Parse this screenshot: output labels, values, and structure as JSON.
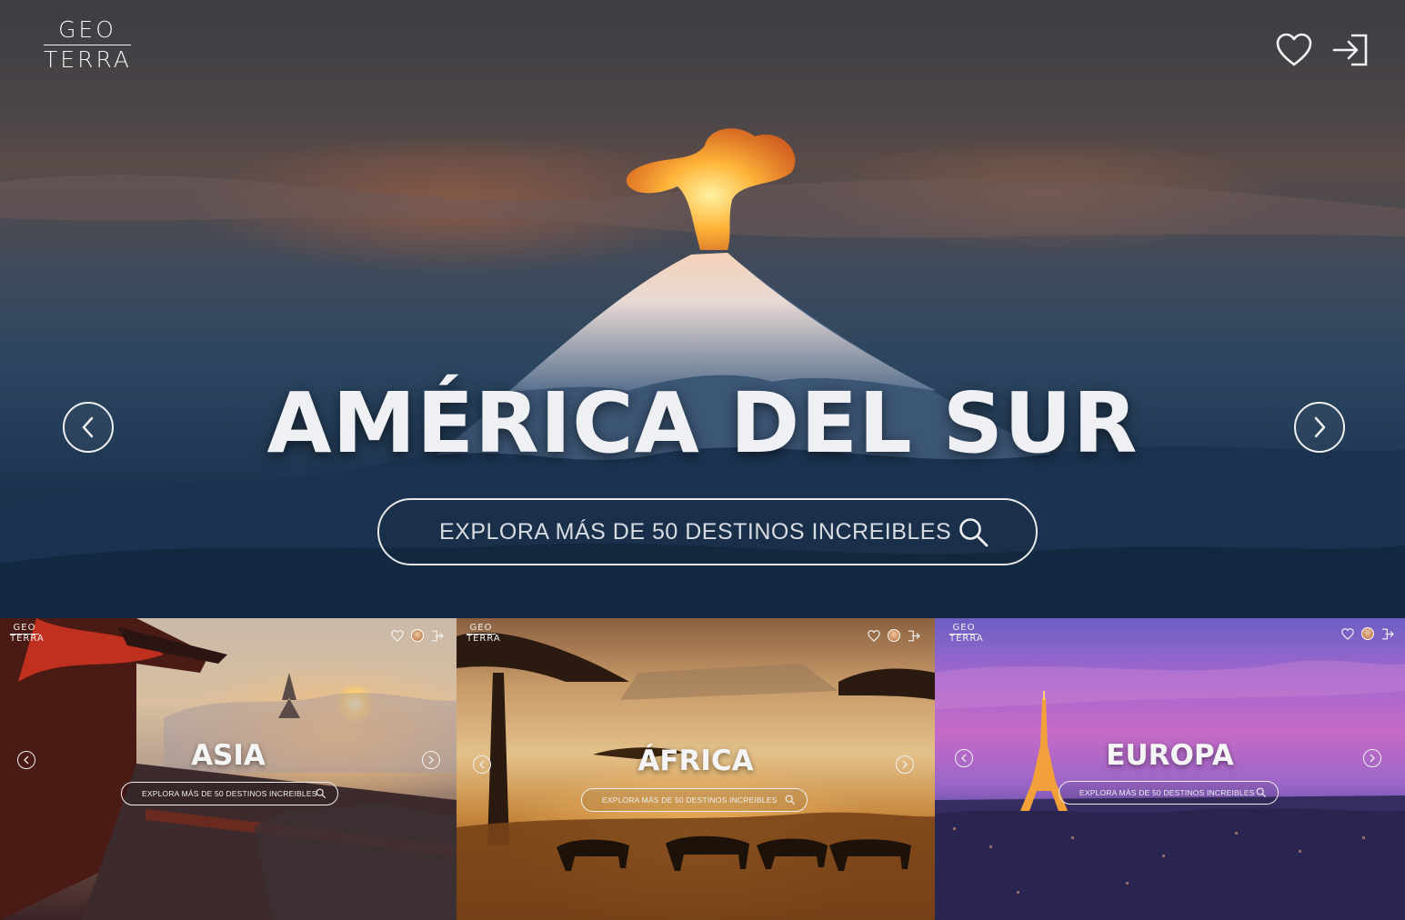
{
  "brand": {
    "line1": "GEO",
    "line2": "TERRA"
  },
  "header": {
    "favorites_icon": "heart-icon",
    "login_icon": "sign-in-icon"
  },
  "hero": {
    "title": "AMÉRICA DEL SUR",
    "search_placeholder": "EXPLORA MÁS DE 50 DESTINOS INCREIBLES",
    "prev_icon": "chevron-left-icon",
    "next_icon": "chevron-right-icon"
  },
  "previews": [
    {
      "title": "ASIA",
      "search_placeholder": "EXPLORA MÁS DE 50 DESTINOS INCREIBLES",
      "brand_line1": "GEO",
      "brand_line2": "TERRA"
    },
    {
      "title": "ÁFRICA",
      "search_placeholder": "EXPLORA MÁS DE 50 DESTINOS INCREIBLES",
      "brand_line1": "GEO",
      "brand_line2": "TERRA"
    },
    {
      "title": "EUROPA",
      "search_placeholder": "EXPLORA MÁS DE 50 DESTINOS INCREIBLES",
      "brand_line1": "GEO",
      "brand_line2": "TERRA"
    }
  ],
  "colors": {
    "text_light": "#f0f0f0",
    "hero_sky": "#3e3d44",
    "hero_ocean": "#1d3550",
    "lava": "#ff9a2a"
  }
}
